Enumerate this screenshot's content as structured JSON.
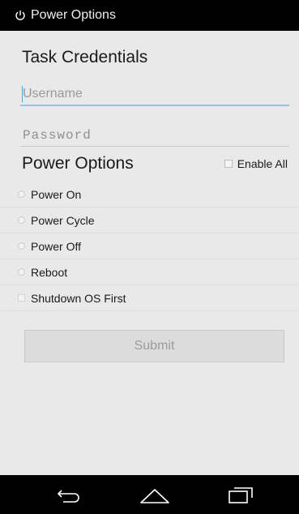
{
  "statusbar": {
    "title": "Power Options",
    "icon": "power-icon"
  },
  "credentials": {
    "title": "Task Credentials",
    "username_placeholder": "Username",
    "password_placeholder": "Password"
  },
  "power": {
    "title": "Power Options",
    "enable_all_label": "Enable All",
    "options": [
      {
        "label": "Power On",
        "control": "radio"
      },
      {
        "label": "Power Cycle",
        "control": "radio"
      },
      {
        "label": "Power Off",
        "control": "radio"
      },
      {
        "label": "Reboot",
        "control": "radio"
      },
      {
        "label": "Shutdown OS First",
        "control": "checkbox"
      }
    ]
  },
  "submit_label": "Submit",
  "navbar": {
    "icons": [
      "back-icon",
      "home-icon",
      "recent-apps-icon"
    ]
  },
  "colors": {
    "background": "#e9e9e9",
    "bar": "#000000",
    "focus_underline": "#86c8e6"
  }
}
